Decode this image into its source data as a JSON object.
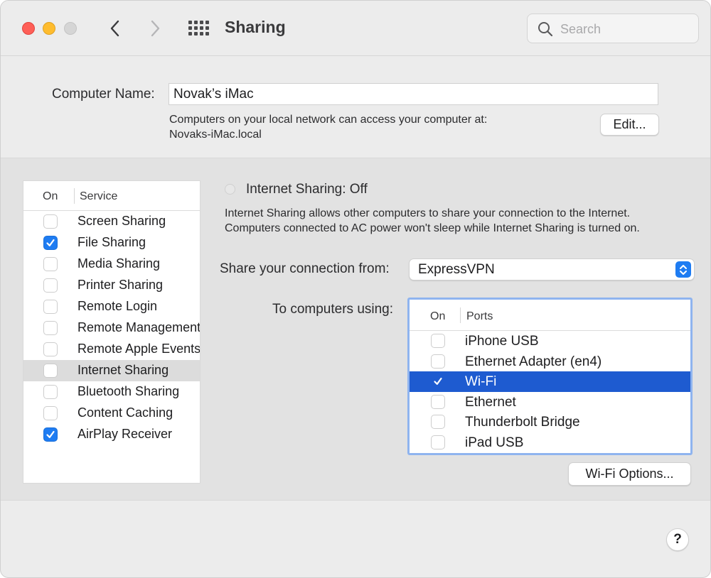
{
  "window": {
    "title": "Sharing",
    "search_placeholder": "Search"
  },
  "computer_name": {
    "label": "Computer Name:",
    "value": "Novak’s iMac",
    "description_line1": "Computers on your local network can access your computer at:",
    "description_line2": "Novaks-iMac.local",
    "edit_button": "Edit..."
  },
  "services": {
    "header_on": "On",
    "header_service": "Service",
    "items": [
      {
        "label": "Screen Sharing",
        "checked": false
      },
      {
        "label": "File Sharing",
        "checked": true
      },
      {
        "label": "Media Sharing",
        "checked": false
      },
      {
        "label": "Printer Sharing",
        "checked": false
      },
      {
        "label": "Remote Login",
        "checked": false
      },
      {
        "label": "Remote Management",
        "checked": false
      },
      {
        "label": "Remote Apple Events",
        "checked": false
      },
      {
        "label": "Internet Sharing",
        "checked": false,
        "selected": true
      },
      {
        "label": "Bluetooth Sharing",
        "checked": false
      },
      {
        "label": "Content Caching",
        "checked": false
      },
      {
        "label": "AirPlay Receiver",
        "checked": true
      }
    ]
  },
  "internet_sharing": {
    "status": "Internet Sharing: Off",
    "description_line1": "Internet Sharing allows other computers to share your connection to the Internet.",
    "description_line2": "Computers connected to AC power won't sleep while Internet Sharing is turned on.",
    "share_from_label": "Share your connection from:",
    "share_from_value": "ExpressVPN",
    "to_computers_label": "To computers using:",
    "ports_header_on": "On",
    "ports_header_ports": "Ports",
    "ports": [
      {
        "label": "iPhone USB",
        "checked": false
      },
      {
        "label": "Ethernet Adapter (en4)",
        "checked": false
      },
      {
        "label": "Wi-Fi",
        "checked": true,
        "selected": true
      },
      {
        "label": "Ethernet",
        "checked": false
      },
      {
        "label": "Thunderbolt Bridge",
        "checked": false
      },
      {
        "label": "iPad USB",
        "checked": false
      }
    ],
    "wifi_options_button": "Wi-Fi Options..."
  },
  "help_button": "?",
  "colors": {
    "accent": "#1e7cf2",
    "selection": "#1e5bd0",
    "close": "#fe5f57",
    "minimize": "#febc2e"
  }
}
